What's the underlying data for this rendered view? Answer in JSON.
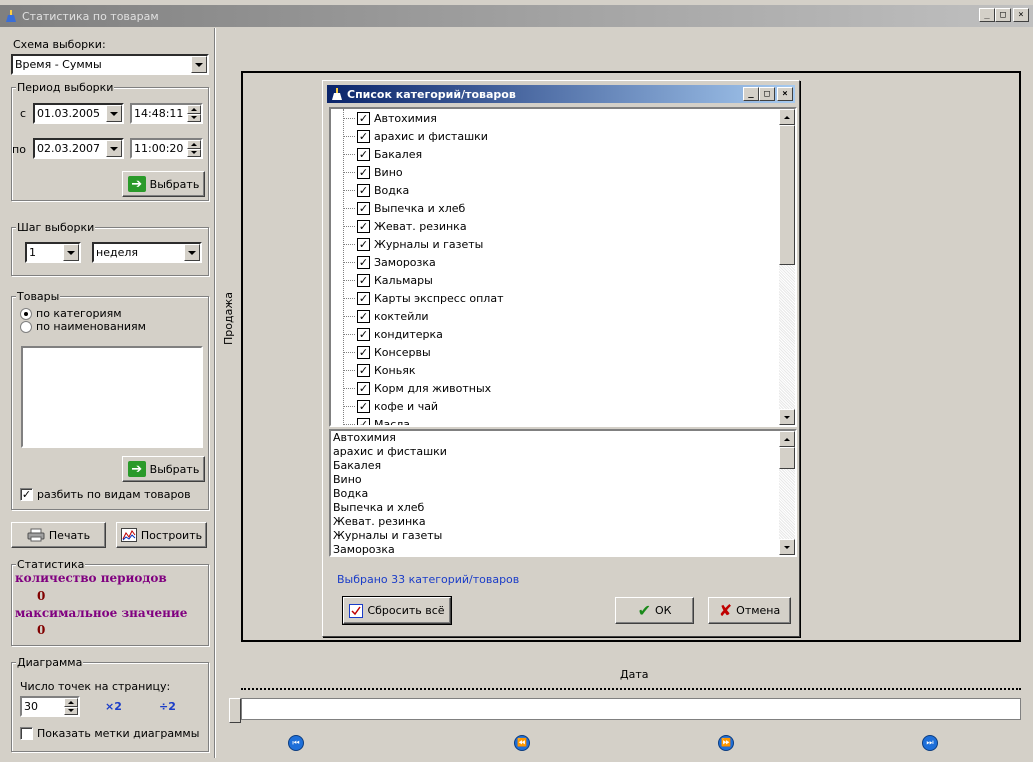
{
  "window": {
    "title": "Статистика по товарам",
    "buttons": [
      "_",
      "□",
      "×"
    ]
  },
  "left": {
    "scheme_label": "Схема выборки:",
    "scheme_value": "Время - Суммы",
    "period": {
      "legend": "Период выборки",
      "from_prefix": "с",
      "from_date": "01.03.2005",
      "from_time": "14:48:11",
      "to_prefix": "по",
      "to_date": "02.03.2007",
      "to_time": "11:00:20",
      "select_button": "Выбрать"
    },
    "step": {
      "legend": "Шаг выборки",
      "count": "1",
      "unit": "неделя"
    },
    "goods": {
      "legend": "Товары",
      "radio_categories": "по категориям",
      "radio_names": "по наименованиям",
      "select_button": "Выбрать",
      "split_checkbox": "разбить по видам товаров"
    },
    "print_button": "Печать",
    "build_button": "Построить",
    "stats": {
      "legend": "Статистика",
      "periods_label": "количество периодов",
      "periods_value": "0",
      "max_label": "максимальное значение",
      "max_value": "0"
    },
    "diagram": {
      "legend": "Диаграмма",
      "points_label": "Число точек на страницу:",
      "points_value": "30",
      "mult_label": "×2",
      "div_label": "÷2",
      "show_labels_checkbox": "Показать метки диаграммы"
    }
  },
  "chart": {
    "ylabel": "Продажа",
    "xlabel": "Дата"
  },
  "dialog": {
    "title": "Список категорий/товаров",
    "tree_items": [
      "Автохимия",
      "арахис и фисташки",
      "Бакалея",
      "Вино",
      "Водка",
      "Выпечка и хлеб",
      "Жеват. резинка",
      "Журналы и газеты",
      "Заморозка",
      "Кальмары",
      "Карты экспресс оплат",
      "коктейли",
      "кондитерка",
      "Консервы",
      "Коньяк",
      "Корм для животных",
      "кофе и чай",
      "Масла"
    ],
    "list_items": [
      "Автохимия",
      "арахис и фисташки",
      "Бакалея",
      "Вино",
      "Водка",
      "Выпечка и хлеб",
      "Жеват. резинка",
      "Журналы и газеты",
      "Заморозка"
    ],
    "selected_info": "Выбрано 33 категорий/товаров",
    "reset_button": "Сбросить всё",
    "ok_button": "ОК",
    "cancel_button": "Отмена"
  },
  "colors": {
    "accent": "#0a246a",
    "stats_key": "#800080",
    "stats_value": "#800000",
    "info": "#1a3cc8"
  }
}
